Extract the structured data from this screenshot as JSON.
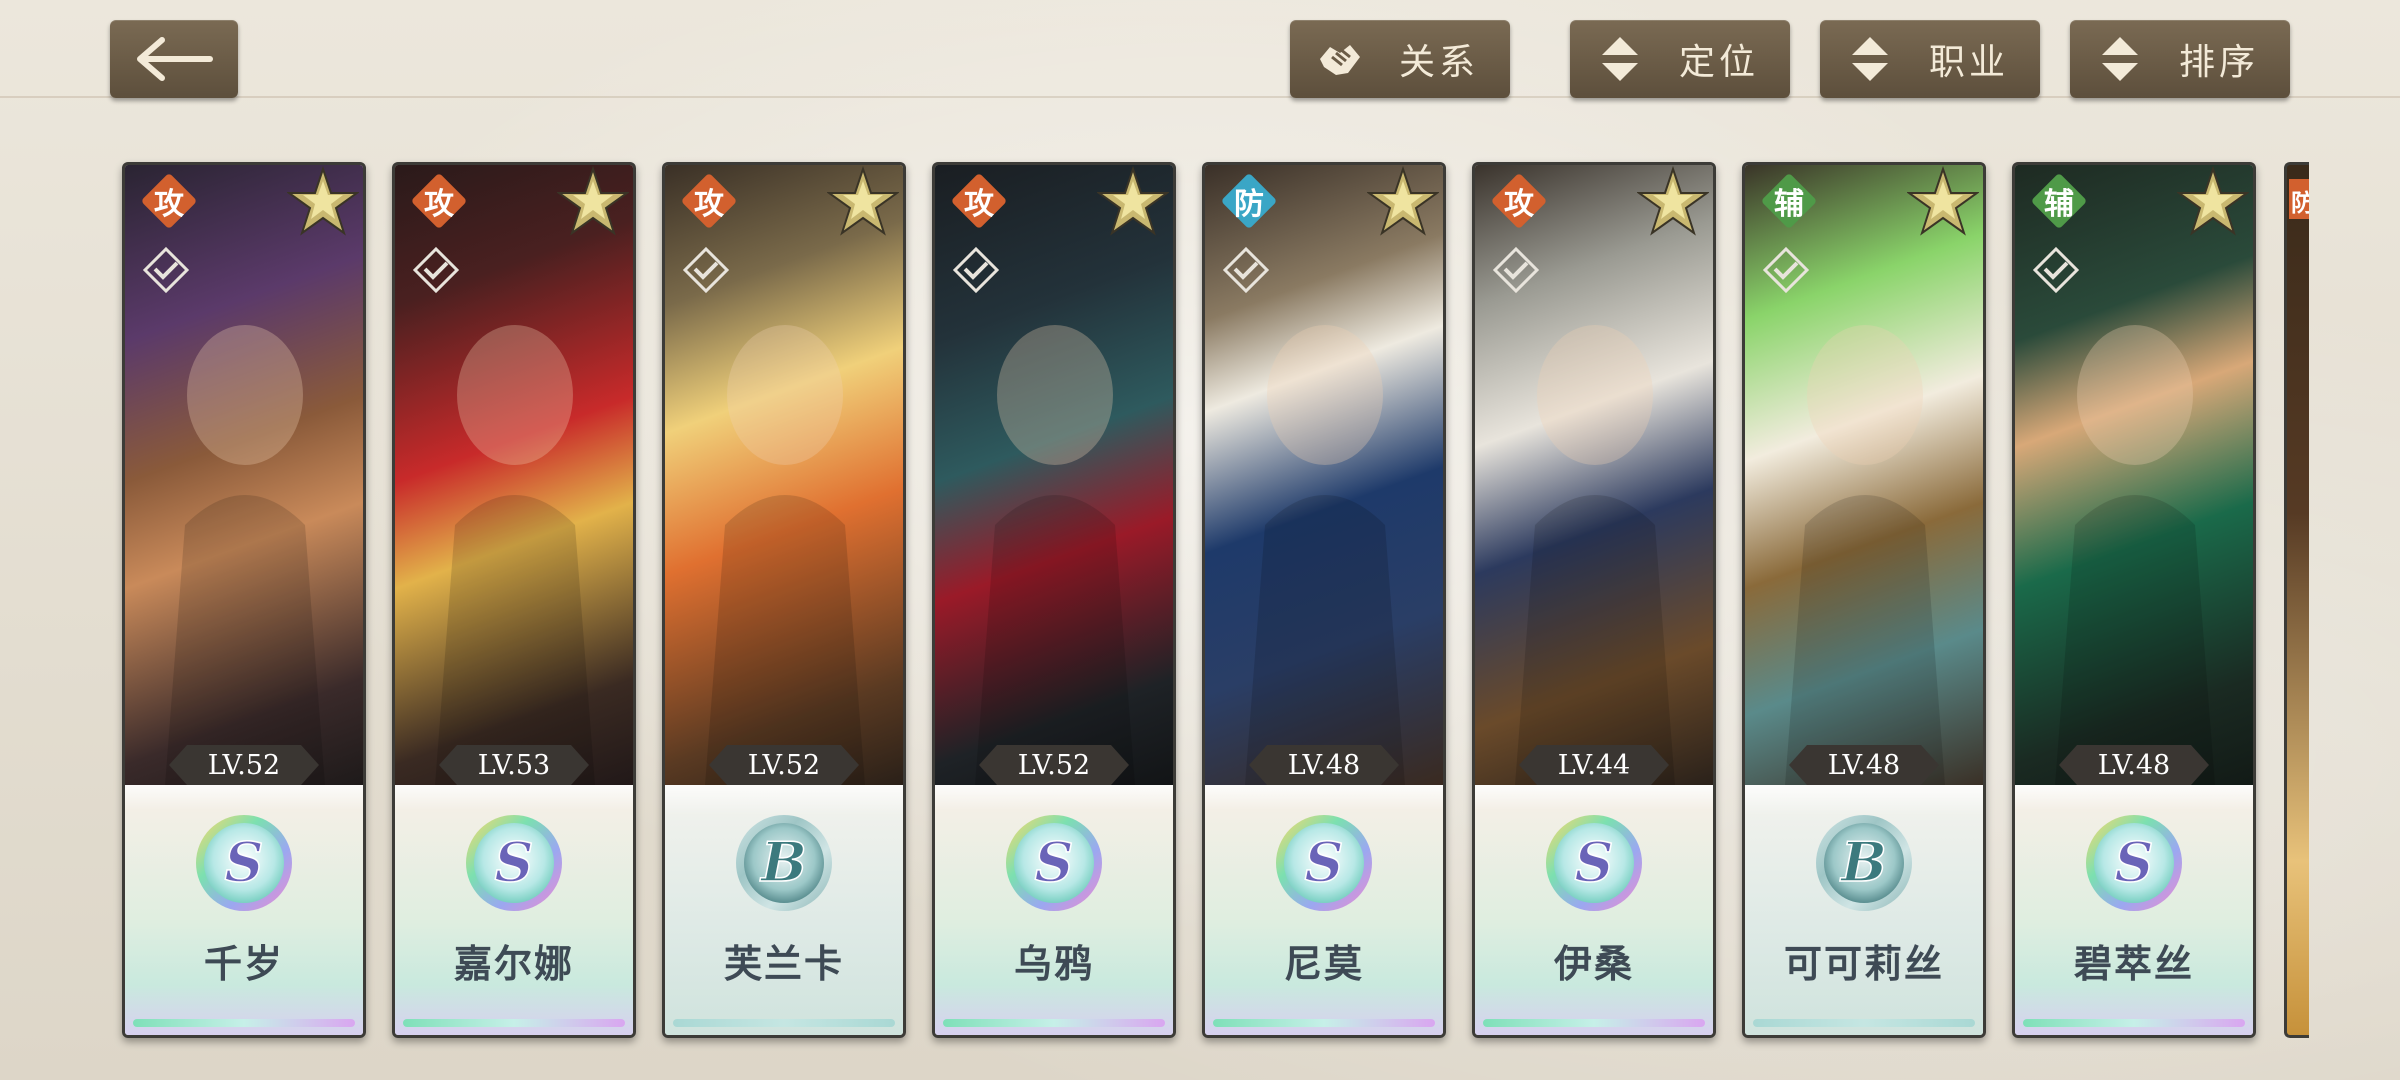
{
  "toolbar": {
    "back_icon": "arrow-left-icon",
    "buttons": [
      {
        "label": "关系",
        "icon": "handshake-icon"
      },
      {
        "label": "定位",
        "icon": "sort-arrows-icon"
      },
      {
        "label": "职业",
        "icon": "sort-arrows-icon"
      },
      {
        "label": "排序",
        "icon": "sort-arrows-icon"
      }
    ]
  },
  "colors": {
    "attack": "#d2602e",
    "defense": "#3aa6c6",
    "support": "#4f9a48",
    "button_bg": "#6b5c47",
    "button_text": "#f3ead8"
  },
  "heroes": [
    {
      "role": "攻",
      "level": "LV.52",
      "rank": "S",
      "name": "千岁"
    },
    {
      "role": "攻",
      "level": "LV.53",
      "rank": "S",
      "name": "嘉尔娜"
    },
    {
      "role": "攻",
      "level": "LV.52",
      "rank": "B",
      "name": "芙兰卡"
    },
    {
      "role": "攻",
      "level": "LV.52",
      "rank": "S",
      "name": "乌鸦"
    },
    {
      "role": "防",
      "level": "LV.48",
      "rank": "S",
      "name": "尼莫"
    },
    {
      "role": "攻",
      "level": "LV.44",
      "rank": "S",
      "name": "伊桑"
    },
    {
      "role": "辅",
      "level": "LV.48",
      "rank": "B",
      "name": "可可莉丝"
    },
    {
      "role": "辅",
      "level": "LV.48",
      "rank": "S",
      "name": "碧萃丝"
    }
  ],
  "partial_card_role": "防"
}
